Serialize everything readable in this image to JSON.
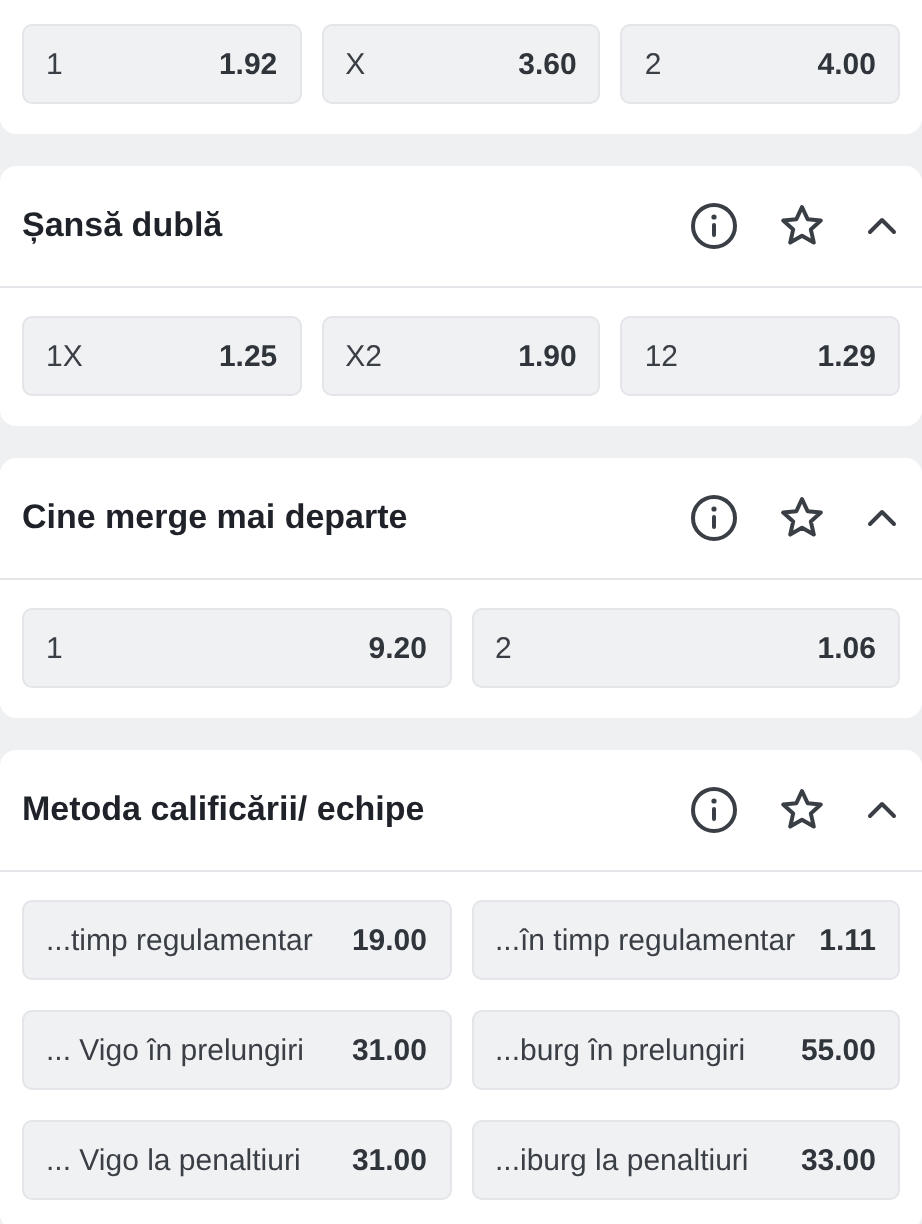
{
  "markets": [
    {
      "odds": [
        {
          "label": "1",
          "value": "1.92"
        },
        {
          "label": "X",
          "value": "3.60"
        },
        {
          "label": "2",
          "value": "4.00"
        }
      ]
    },
    {
      "title": "Șansă dublă",
      "expanded": true,
      "odds": [
        {
          "label": "1X",
          "value": "1.25"
        },
        {
          "label": "X2",
          "value": "1.90"
        },
        {
          "label": "12",
          "value": "1.29"
        }
      ]
    },
    {
      "title": "Cine merge mai departe",
      "expanded": true,
      "odds": [
        {
          "label": "1",
          "value": "9.20"
        },
        {
          "label": "2",
          "value": "1.06"
        }
      ]
    },
    {
      "title": "Metoda calificării/ echipe",
      "expanded": true,
      "odds": [
        {
          "label": "...timp regulamentar",
          "value": "19.00"
        },
        {
          "label": "...în timp regulamentar",
          "value": "1.11"
        },
        {
          "label": "... Vigo în prelungiri",
          "value": "31.00"
        },
        {
          "label": "...burg în prelungiri",
          "value": "55.00"
        },
        {
          "label": "... Vigo la penaltiuri",
          "value": "31.00"
        },
        {
          "label": "...iburg la penaltiuri",
          "value": "33.00"
        }
      ]
    }
  ]
}
